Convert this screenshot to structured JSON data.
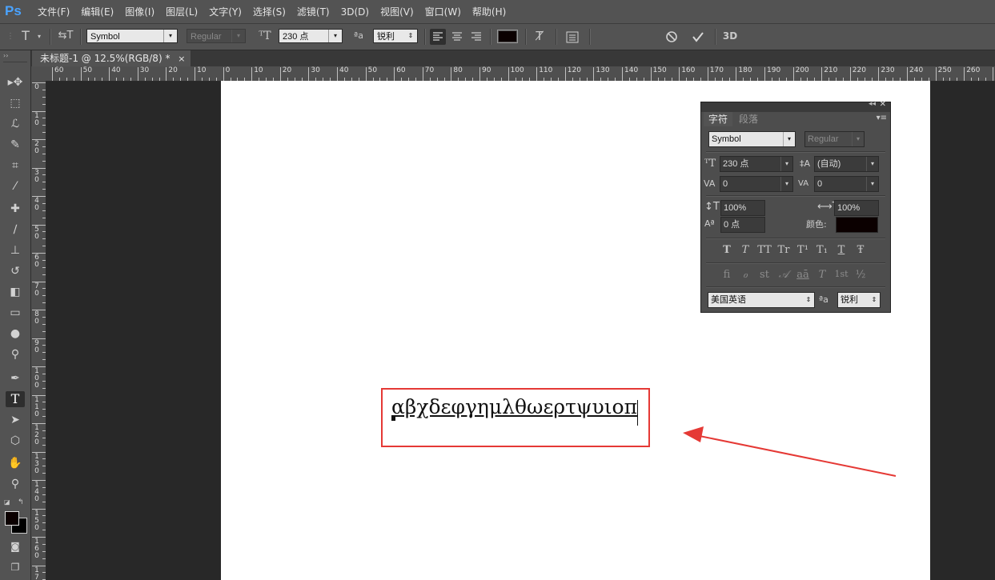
{
  "app": {
    "logo": "Ps"
  },
  "menu": [
    "文件(F)",
    "编辑(E)",
    "图像(I)",
    "图层(L)",
    "文字(Y)",
    "选择(S)",
    "滤镜(T)",
    "3D(D)",
    "视图(V)",
    "窗口(W)",
    "帮助(H)"
  ],
  "options": {
    "tool_icon": "T",
    "font_family": "Symbol",
    "font_style": "Regular",
    "font_size": "230 点",
    "antialias_prefix": "ªa",
    "antialias": "锐利",
    "three_d": "3D",
    "color": "#0b0000"
  },
  "document": {
    "tab_title": "未标题-1 @ 12.5%(RGB/8) *",
    "tab_close": "×"
  },
  "ruler": {
    "h_labels": [
      "60",
      "50",
      "40",
      "30",
      "20",
      "10",
      "0",
      "10",
      "20",
      "30",
      "40",
      "50",
      "60",
      "70",
      "80",
      "90",
      "100",
      "110",
      "120",
      "130",
      "140",
      "150",
      "160",
      "170",
      "180",
      "190",
      "200",
      "210",
      "220",
      "230",
      "240",
      "250",
      "260",
      "2"
    ],
    "v_labels": [
      "0",
      "10",
      "20",
      "30",
      "40",
      "50",
      "60",
      "70",
      "80",
      "90",
      "100",
      "110",
      "120",
      "130",
      "140",
      "150",
      "160",
      "170"
    ]
  },
  "canvas": {
    "text_content": "αβχδεφγημλθωερτψυιοπ",
    "highlight_color": "#e53935",
    "arrow_color": "#e53935"
  },
  "char_panel": {
    "tabs": [
      "字符",
      "段落"
    ],
    "font_family": "Symbol",
    "font_style": "Regular",
    "font_size": "230 点",
    "leading": "(自动)",
    "kerning": "0",
    "tracking": "0",
    "vertical_scale": "100%",
    "horizontal_scale": "100%",
    "baseline_shift": "0 点",
    "color_label": "颜色:",
    "color": "#0b0000",
    "language": "美国英语",
    "antialias_prefix": "ªa",
    "antialias": "锐利",
    "style_buttons": [
      "T",
      "T",
      "TT",
      "Tr",
      "T¹",
      "T₁",
      "T",
      "Ŧ"
    ],
    "opentype_buttons": [
      "ﬁ",
      "ℴ",
      "st",
      "𝒜",
      "aā",
      "T",
      "1st",
      "½"
    ]
  }
}
